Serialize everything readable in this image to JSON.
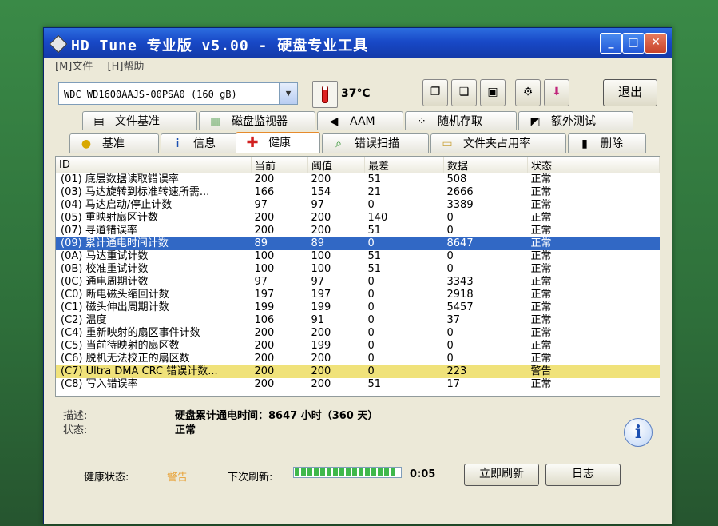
{
  "window": {
    "title": "HD Tune 专业版 v5.00 - 硬盘专业工具"
  },
  "menu": [
    "[M]文件",
    "[H]帮助"
  ],
  "toolbar": {
    "drive": "WDC WD1600AAJS-00PSA0 (160 gB)",
    "temperature": "37℃",
    "exit_label": "退出"
  },
  "tabs_top": [
    "文件基准",
    "磁盘监视器",
    "AAM",
    "随机存取",
    "额外测试"
  ],
  "tabs_bottom": [
    "基准",
    "信息",
    "健康",
    "错误扫描",
    "文件夹占用率",
    "删除"
  ],
  "table": {
    "headers": [
      "ID",
      "当前",
      "阈值",
      "最差",
      "数据",
      "状态"
    ],
    "rows": [
      {
        "id": "(01) 底层数据读取错误率",
        "cur": "200",
        "thr": "200",
        "worst": "51",
        "data": "508",
        "status": "正常"
      },
      {
        "id": "(03) 马达旋转到标准转速所需...",
        "cur": "166",
        "thr": "154",
        "worst": "21",
        "data": "2666",
        "status": "正常"
      },
      {
        "id": "(04) 马达启动/停止计数",
        "cur": "97",
        "thr": "97",
        "worst": "0",
        "data": "3389",
        "status": "正常"
      },
      {
        "id": "(05) 重映射扇区计数",
        "cur": "200",
        "thr": "200",
        "worst": "140",
        "data": "0",
        "status": "正常"
      },
      {
        "id": "(07) 寻道错误率",
        "cur": "200",
        "thr": "200",
        "worst": "51",
        "data": "0",
        "status": "正常"
      },
      {
        "id": "(09) 累计通电时间计数",
        "cur": "89",
        "thr": "89",
        "worst": "0",
        "data": "8647",
        "status": "正常"
      },
      {
        "id": "(0A) 马达重试计数",
        "cur": "100",
        "thr": "100",
        "worst": "51",
        "data": "0",
        "status": "正常"
      },
      {
        "id": "(0B) 校准重试计数",
        "cur": "100",
        "thr": "100",
        "worst": "51",
        "data": "0",
        "status": "正常"
      },
      {
        "id": "(0C) 通电周期计数",
        "cur": "97",
        "thr": "97",
        "worst": "0",
        "data": "3343",
        "status": "正常"
      },
      {
        "id": "(C0) 断电磁头缩回计数",
        "cur": "197",
        "thr": "197",
        "worst": "0",
        "data": "2918",
        "status": "正常"
      },
      {
        "id": "(C1) 磁头伸出周期计数",
        "cur": "199",
        "thr": "199",
        "worst": "0",
        "data": "5457",
        "status": "正常"
      },
      {
        "id": "(C2) 温度",
        "cur": "106",
        "thr": "91",
        "worst": "0",
        "data": "37",
        "status": "正常"
      },
      {
        "id": "(C4) 重新映射的扇区事件计数",
        "cur": "200",
        "thr": "200",
        "worst": "0",
        "data": "0",
        "status": "正常"
      },
      {
        "id": "(C5) 当前待映射的扇区数",
        "cur": "200",
        "thr": "199",
        "worst": "0",
        "data": "0",
        "status": "正常"
      },
      {
        "id": "(C6) 脱机无法校正的扇区数",
        "cur": "200",
        "thr": "200",
        "worst": "0",
        "data": "0",
        "status": "正常"
      },
      {
        "id": "(C7) Ultra DMA CRC 错误计数...",
        "cur": "200",
        "thr": "200",
        "worst": "0",
        "data": "223",
        "status": "警告"
      },
      {
        "id": "(C8) 写入错误率",
        "cur": "200",
        "thr": "200",
        "worst": "51",
        "data": "17",
        "status": "正常"
      }
    ]
  },
  "info": {
    "desc_label": "描述:",
    "desc_value": "硬盘累计通电时间：8647 小时（360 天）",
    "state_label": "状态:",
    "state_value": "正常"
  },
  "status": {
    "health_label": "健康状态:",
    "health_value": "警告",
    "next_label": "下次刷新:",
    "countdown": "0:05",
    "refresh_label": "立即刷新",
    "log_label": "日志",
    "progress_fraction": 0.95
  },
  "colors": {
    "selected_row": "#3168c5",
    "warn_row": "#f0e27a",
    "health_warn": "#e8a33a"
  }
}
